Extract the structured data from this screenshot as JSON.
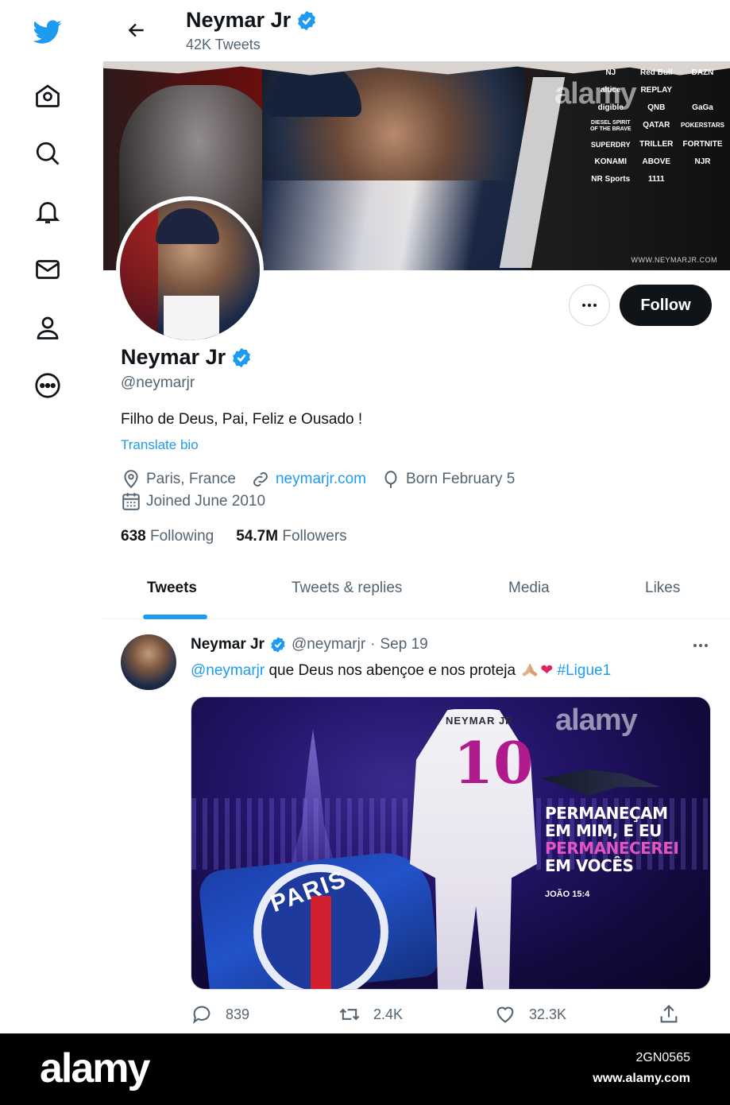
{
  "header": {
    "title": "Neymar Jr",
    "tweet_count": "42K Tweets"
  },
  "banner": {
    "sponsors": [
      "NJ",
      "Red Bull",
      "DAZN",
      "altice",
      "REPLAY",
      "",
      "digible",
      "QNB",
      "GaGa",
      "DIESEL SPIRIT OF THE BRAVE",
      "QATAR",
      "POKERSTARS",
      "SUPERDRY",
      "TRILLER",
      "FORTNITE",
      "KONAMI",
      "ABOVE",
      "NJR",
      "NR Sports",
      "1111",
      ""
    ],
    "site": "WWW.NEYMARJR.COM",
    "watermark": "alamy"
  },
  "profile": {
    "name": "Neymar Jr",
    "handle": "@neymarjr",
    "bio": "Filho de Deus, Pai, Feliz e Ousado !",
    "translate": "Translate bio",
    "location": "Paris, France",
    "website": "neymarjr.com",
    "birthday": "Born February 5",
    "joined": "Joined June 2010",
    "following_count": "638",
    "following_label": "Following",
    "followers_count": "54.7M",
    "followers_label": "Followers",
    "follow_button": "Follow"
  },
  "tabs": [
    "Tweets",
    "Tweets & replies",
    "Media",
    "Likes"
  ],
  "tweet": {
    "name": "Neymar Jr",
    "handle": "@neymarjr",
    "dot": "·",
    "date": "Sep 19",
    "mention": "@neymarjr",
    "text": "que Deus nos abençoe e nos proteja",
    "heart": "❤",
    "hashtag": "#Ligue1",
    "media": {
      "jersey_name": "NEYMAR JR",
      "jersey_number": "10",
      "crest_text": "PARIS",
      "quote_line1": "PERMANEÇAM",
      "quote_line2": "EM MIM, E EU",
      "quote_line3": "PERMANECEREI",
      "quote_line4": "EM VOCÊS",
      "verse": "JOÃO 15:4",
      "watermark": "alamy"
    },
    "replies": "839",
    "retweets": "2.4K",
    "likes": "32.3K"
  },
  "footer": {
    "brand": "alamy",
    "image_code": "2GN0565",
    "url": "www.alamy.com"
  },
  "colors": {
    "accent": "#1d9bf0",
    "text": "#0f1419",
    "muted": "#536471",
    "verified": "#1d9bf0"
  }
}
